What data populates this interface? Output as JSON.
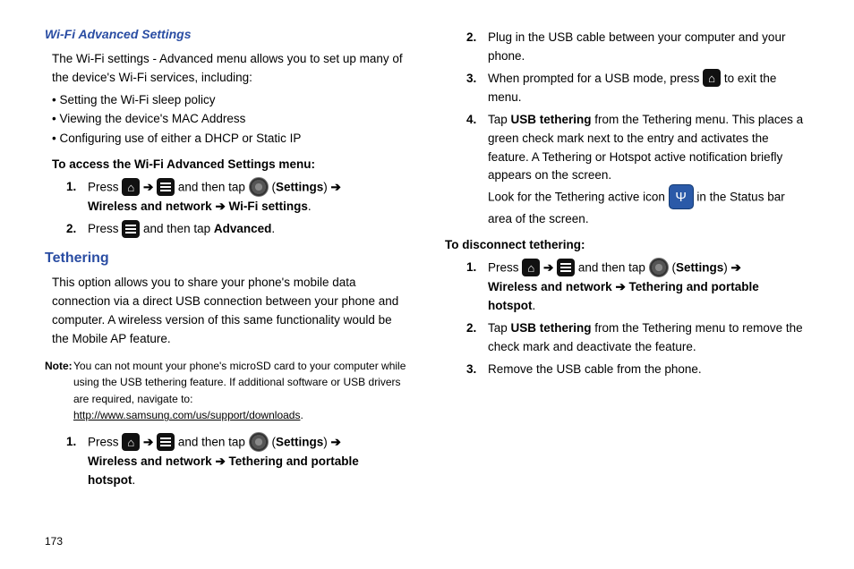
{
  "page_number": "173",
  "left": {
    "h4": "Wi-Fi Advanced Settings",
    "intro1": "The Wi-Fi settings - Advanced menu allows you to set up many of the device's Wi-Fi services, including:",
    "bullets": [
      "Setting the Wi-Fi sleep policy",
      "Viewing the device's MAC Address",
      "Configuring use of either a DHCP or Static IP"
    ],
    "leadin": "To access the Wi-Fi Advanced Settings menu:",
    "step1": {
      "marker": "1.",
      "press": "Press ",
      "and_then_tap": " and then tap ",
      "settings_open": " (",
      "settings_word": "Settings",
      "settings_close": ") ",
      "line2a": "Wireless and network",
      "line2b": "Wi-Fi settings",
      "period": "."
    },
    "step2": {
      "marker": "2.",
      "press": "Press ",
      "and_then_tap": " and then tap ",
      "advanced": "Advanced",
      "period": "."
    },
    "h3": "Tethering",
    "tether_intro": "This option allows you to share your phone's mobile data connection via a direct USB connection between your phone and computer. A wireless version of this same functionality would be the Mobile AP feature.",
    "note_label": "Note:",
    "note_text": "You can not mount your phone's microSD card to your computer while using the USB tethering feature. If additional software or USB drivers are required, navigate to: ",
    "note_link": "http://www.samsung.com/us/support/downloads",
    "note_period": ".",
    "teth_step1": {
      "marker": "1.",
      "press": "Press ",
      "and_then_tap": " and then tap ",
      "settings_open": " (",
      "settings_word": "Settings",
      "settings_close": ") ",
      "line2a": "Wireless and network",
      "line2b": "Tethering and portable hotspot",
      "period": "."
    }
  },
  "right": {
    "step2": {
      "marker": "2.",
      "text": "Plug in the USB cable between your computer and your phone."
    },
    "step3": {
      "marker": "3.",
      "a": "When prompted for a USB mode, press ",
      "b": " to exit the menu."
    },
    "step4": {
      "marker": "4.",
      "a": "Tap ",
      "usb_teth": "USB tethering",
      "b": " from the Tethering menu. This places a green check mark next to the entry and activates the feature. A Tethering or Hotspot active notification briefly appears on the screen.",
      "c": "Look for the Tethering active icon ",
      "d": " in the Status bar area of the screen."
    },
    "leadin": "To disconnect tethering:",
    "d1": {
      "marker": "1.",
      "press": "Press ",
      "and_then_tap": " and then tap ",
      "settings_open": " (",
      "settings_word": "Settings",
      "settings_close": ") ",
      "line2a": "Wireless and network",
      "line2b": "Tethering and portable hotspot",
      "period": "."
    },
    "d2": {
      "marker": "2.",
      "a": "Tap ",
      "usb_teth": "USB tethering",
      "b": " from the Tethering menu to remove the check mark and deactivate the feature."
    },
    "d3": {
      "marker": "3.",
      "text": "Remove the USB cable from the phone."
    }
  },
  "glyph_arrow": "➔"
}
